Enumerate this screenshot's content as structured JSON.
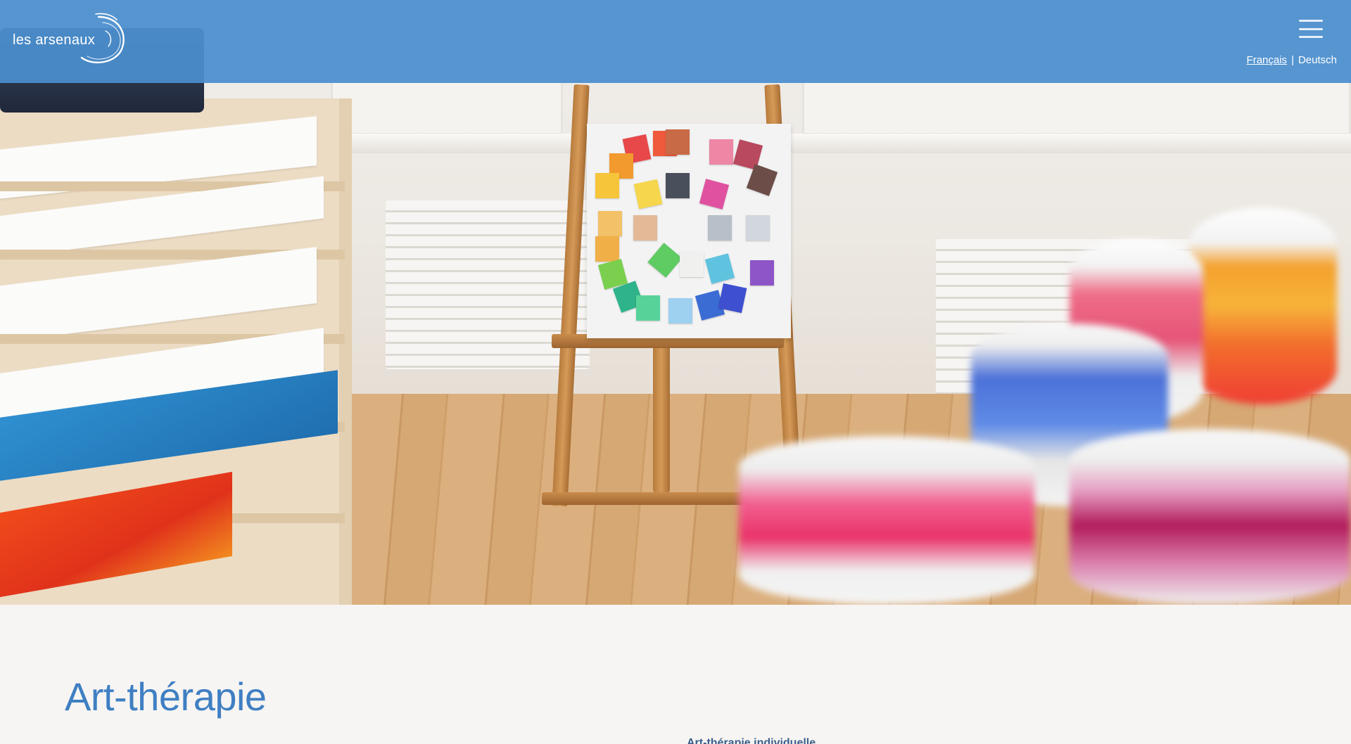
{
  "header": {
    "logo_text": "les arsenaux",
    "menu_icon": "hamburger-icon",
    "languages": [
      {
        "label": "Français",
        "active": true
      },
      {
        "label": "Deutsch",
        "active": false
      }
    ],
    "lang_separator": "|"
  },
  "hero": {
    "image_description_icon": "art-studio-photo"
  },
  "main": {
    "title": "Art-thérapie",
    "subheading": "Art-thérapie individuelle"
  },
  "colors": {
    "header_blue": "#4a8ecd",
    "title_blue": "#3f7fc3",
    "page_bg": "#f7f5f3"
  }
}
